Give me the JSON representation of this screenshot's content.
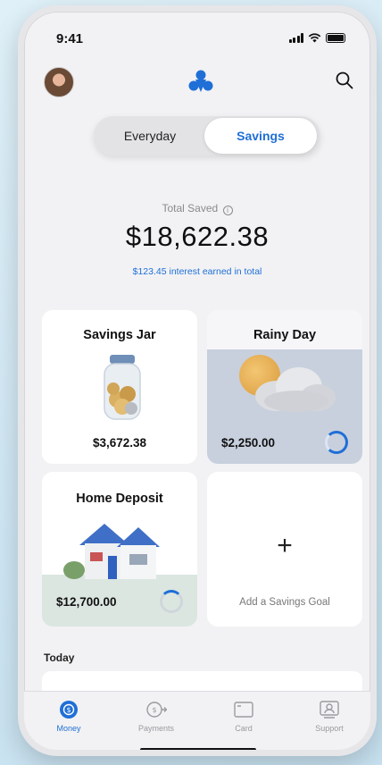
{
  "status_bar": {
    "time": "9:41"
  },
  "header": {
    "avatar": "profile-avatar",
    "logo": "app-logo",
    "search_icon": "search-icon"
  },
  "segment": {
    "options": [
      "Everyday",
      "Savings"
    ],
    "selected": "Savings"
  },
  "summary": {
    "label": "Total Saved",
    "info_icon": "ⓘ",
    "amount": "$18,622.38",
    "interest": "$123.45 interest earned in total"
  },
  "goals": [
    {
      "title": "Savings Jar",
      "amount": "$3,672.38",
      "icon": "jar-icon"
    },
    {
      "title": "Rainy Day",
      "amount": "$2,250.00",
      "icon": "cloud-sun-icon"
    },
    {
      "title": "Home Deposit",
      "amount": "$12,700.00",
      "icon": "house-icon"
    }
  ],
  "add_goal": {
    "symbol": "+",
    "label": "Add a Savings Goal"
  },
  "activity": {
    "heading": "Today"
  },
  "tabbar": {
    "items": [
      {
        "label": "Money",
        "icon": "money-icon",
        "active": true
      },
      {
        "label": "Payments",
        "icon": "payments-icon",
        "active": false
      },
      {
        "label": "Card",
        "icon": "card-icon",
        "active": false
      },
      {
        "label": "Support",
        "icon": "support-icon",
        "active": false
      }
    ]
  },
  "colors": {
    "accent": "#1f6fd6",
    "background": "#f2f2f4",
    "card": "#ffffff",
    "rainy_card": "#c8d0de",
    "home_card": "#dbe6e1"
  }
}
